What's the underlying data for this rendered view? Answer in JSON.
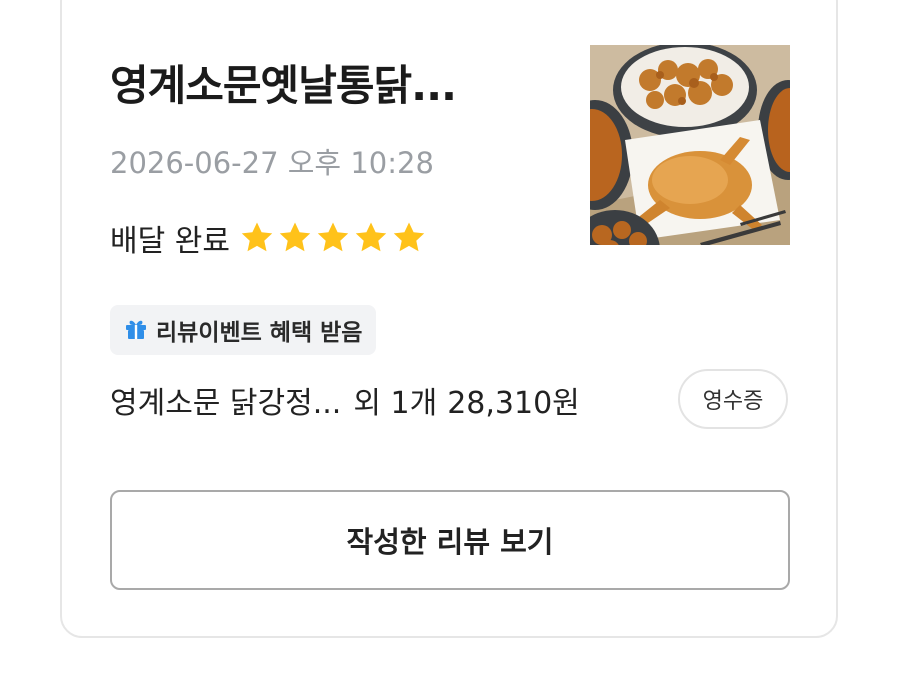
{
  "order": {
    "store_name": "영계소문옛날통닭...",
    "datetime": "2026-06-27 오후 10:28",
    "status": "배달 완료",
    "rating": 5,
    "rating_max": 5,
    "star_color": "#FFC21A",
    "thumbnail_icon": "fried-chicken-photo",
    "event_badge": {
      "icon": "gift-icon",
      "label": "리뷰이벤트 혜택 받음"
    },
    "menu_summary": "영계소문 닭강정...",
    "menu_extra": "외 1개",
    "price": "28,310원",
    "receipt_label": "영수증",
    "review_button_label": "작성한 리뷰 보기"
  }
}
